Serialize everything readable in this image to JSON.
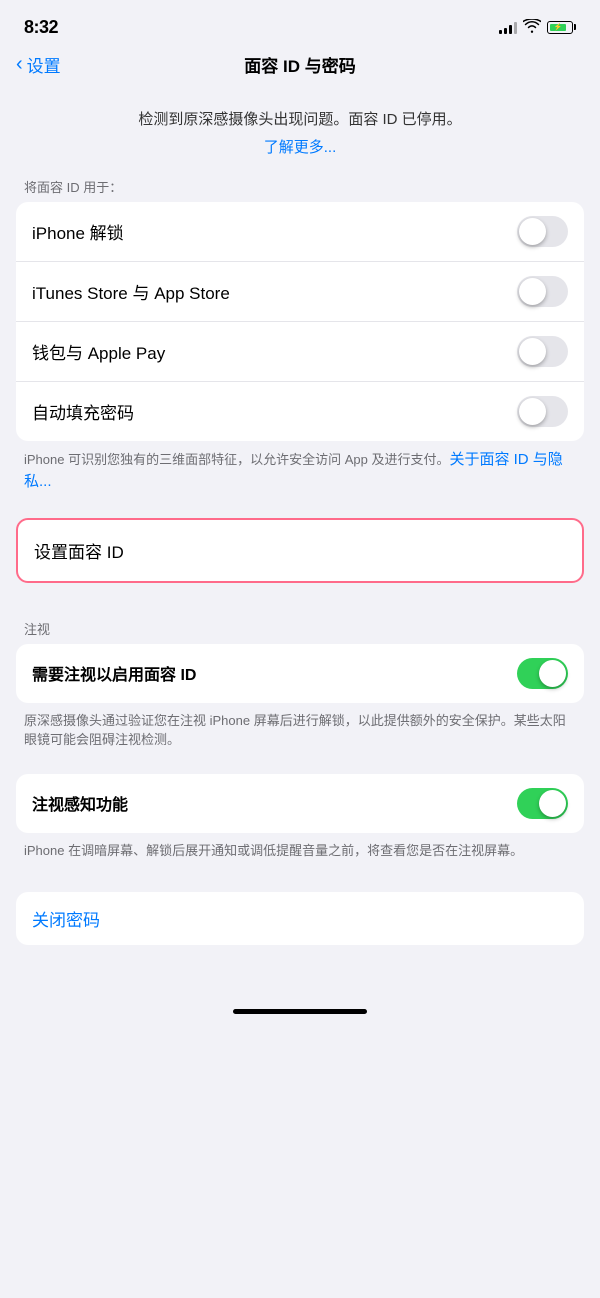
{
  "statusBar": {
    "time": "8:32",
    "battery_percent": 80
  },
  "navBar": {
    "back_label": "设置",
    "title": "面容 ID 与密码"
  },
  "warning": {
    "message": "检测到原深感摄像头出现问题。面容 ID 已停用。",
    "link_text": "了解更多..."
  },
  "faceIdSection": {
    "section_label": "将面容 ID 用于：",
    "rows": [
      {
        "label": "iPhone 解锁",
        "toggle": false
      },
      {
        "label": "iTunes Store 与 App Store",
        "toggle": false
      },
      {
        "label": "钱包与 Apple Pay",
        "toggle": false
      },
      {
        "label": "自动填充密码",
        "toggle": false
      }
    ],
    "note": "iPhone 可识别您独有的三维面部特征，以允许安全访问 App 及进行支付。",
    "note_link": "关于面容 ID 与隐私..."
  },
  "setupFaceId": {
    "label": "设置面容 ID"
  },
  "attentionSection": {
    "section_label": "注视",
    "rows": [
      {
        "label": "需要注视以启用面容 ID",
        "toggle": true,
        "note": "原深感摄像头通过验证您在注视 iPhone 屏幕后进行解锁，以此提供额外的安全保护。某些太阳眼镜可能会阻碍注视检测。"
      },
      {
        "label": "注视感知功能",
        "toggle": true,
        "note": "iPhone 在调暗屏幕、解锁后展开通知或调低提醒音量之前，将查看您是否在注视屏幕。"
      }
    ]
  },
  "passcode": {
    "label": "关闭密码"
  }
}
